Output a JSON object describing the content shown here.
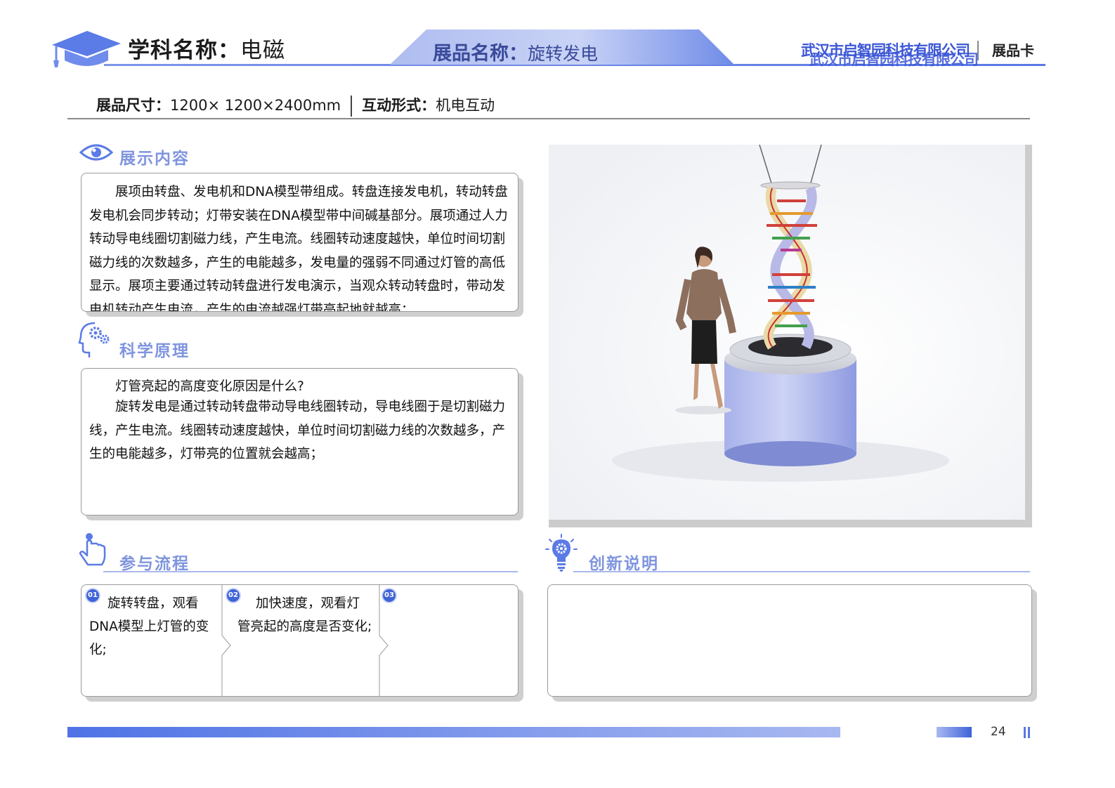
{
  "header": {
    "subject_label": "学科名称：",
    "subject_value": "电磁",
    "exhibit_label": "展品名称：",
    "exhibit_value": "旋转发电",
    "company": "武汉市启智园科技有限公司",
    "card_label": "展品卡"
  },
  "specs": {
    "size_label": "展品尺寸：",
    "size_value": "1200× 1200×2400mm",
    "interaction_label": "互动形式：",
    "interaction_value": "机电互动"
  },
  "sections": {
    "display": {
      "title": "展示内容",
      "text": "展项由转盘、发电机和DNA模型带组成。转盘连接发电机，转动转盘发电机会同步转动；灯带安装在DNA模型带中间碱基部分。展项通过人力转动导电线圈切割磁力线，产生电流。线圈转动速度越快，单位时间切割磁力线的次数越多，产生的电能越多，发电量的强弱不同通过灯管的高低显示。展项主要通过转动转盘进行发电演示，当观众转动转盘时，带动发电机转动产生电流，产生的电流越强灯带亮起地就越高；"
    },
    "principle": {
      "title": "科学原理",
      "question": "灯管亮起的高度变化原因是什么?",
      "text": "旋转发电是通过转动转盘带动导电线圈转动，导电线圈于是切割磁力线，产生电流。线圈转动速度越快，单位时间切割磁力线的次数越多，产生的电能越多，灯带亮的位置就会越高；"
    },
    "process": {
      "title": "参与流程",
      "steps": [
        {
          "num": "01",
          "text": "旋转转盘，观看DNA模型上灯管的变化;"
        },
        {
          "num": "02",
          "text": "加快速度，观看灯管亮起的高度是否变化;"
        },
        {
          "num": "03",
          "text": ""
        }
      ]
    },
    "innovation": {
      "title": "创新说明",
      "text": ""
    }
  },
  "footer": {
    "page_number": "24"
  },
  "icons": {
    "logo": "graduation-cap-icon",
    "display": "eye-icon",
    "principle": "head-gears-icon",
    "process": "pointing-hand-icon",
    "innovation": "lightbulb-gear-icon"
  },
  "colors": {
    "accent": "#5a78e6",
    "title_blue": "#7f95de",
    "company_blue": "#3c57d6"
  }
}
